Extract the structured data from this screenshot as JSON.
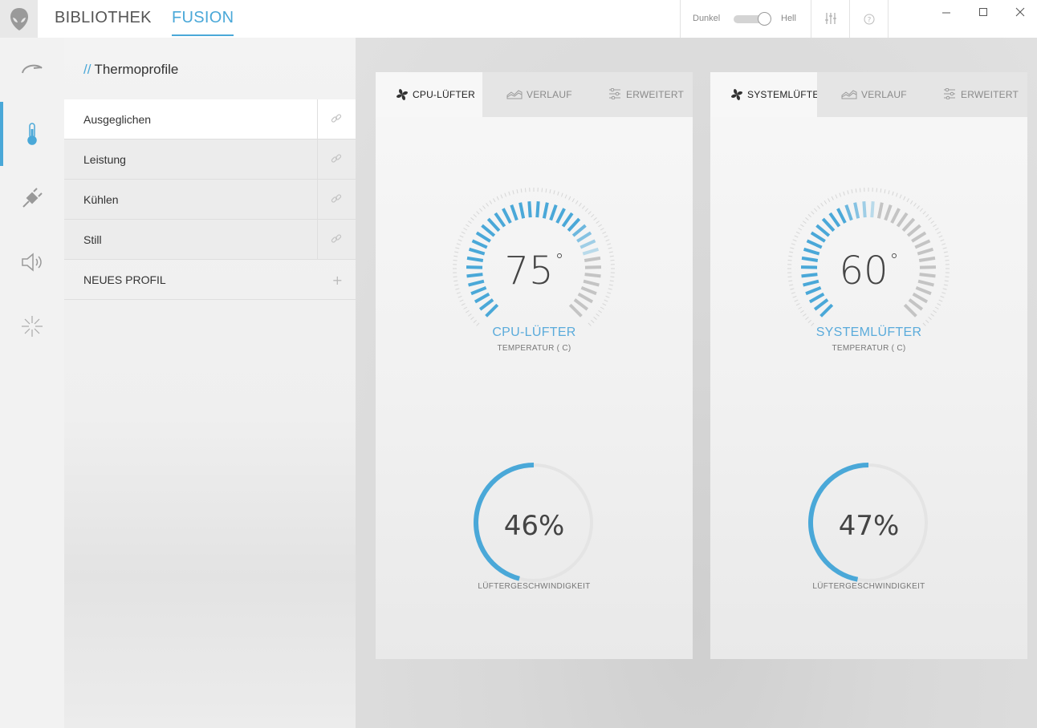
{
  "nav": {
    "library": "BIBLIOTHEK",
    "fusion": "FUSION"
  },
  "theme": {
    "dark_label": "Dunkel",
    "light_label": "Hell",
    "selected": "Hell"
  },
  "rail": {
    "items": [
      "speed-icon",
      "thermometer-icon",
      "power-plug-icon",
      "speaker-icon",
      "lighting-icon"
    ],
    "active": "thermometer-icon"
  },
  "profiles": {
    "title_prefix": "//",
    "title": "Thermoprofile",
    "items": [
      {
        "name": "Ausgeglichen",
        "active": true
      },
      {
        "name": "Leistung",
        "active": false
      },
      {
        "name": "Kühlen",
        "active": false
      },
      {
        "name": "Still",
        "active": false
      }
    ],
    "new_profile": "NEUES PROFIL"
  },
  "fans": [
    {
      "tabs": [
        "CPU-LÜFTER",
        "VERLAUF",
        "ERWEITERT"
      ],
      "name": "CPU-LÜFTER",
      "temperature": "75",
      "temperature_label": "TEMPERATUR ( C)",
      "temperature_fill": 0.77,
      "speed": "46%",
      "speed_value": 46,
      "speed_label": "LÜFTERGESCHWINDIGKEIT"
    },
    {
      "tabs": [
        "SYSTEMLÜFTER",
        "VERLAUF",
        "ERWEITERT"
      ],
      "name": "SYSTEMLÜFTER",
      "temperature": "60",
      "temperature_label": "TEMPERATUR ( C)",
      "temperature_fill": 0.53,
      "speed": "47%",
      "speed_value": 47,
      "speed_label": "LÜFTERGESCHWINDIGKEIT"
    }
  ],
  "colors": {
    "accent": "#4aa8d8",
    "gauge_inactive": "#c4c4c4",
    "ring_track": "#e4e4e4"
  }
}
